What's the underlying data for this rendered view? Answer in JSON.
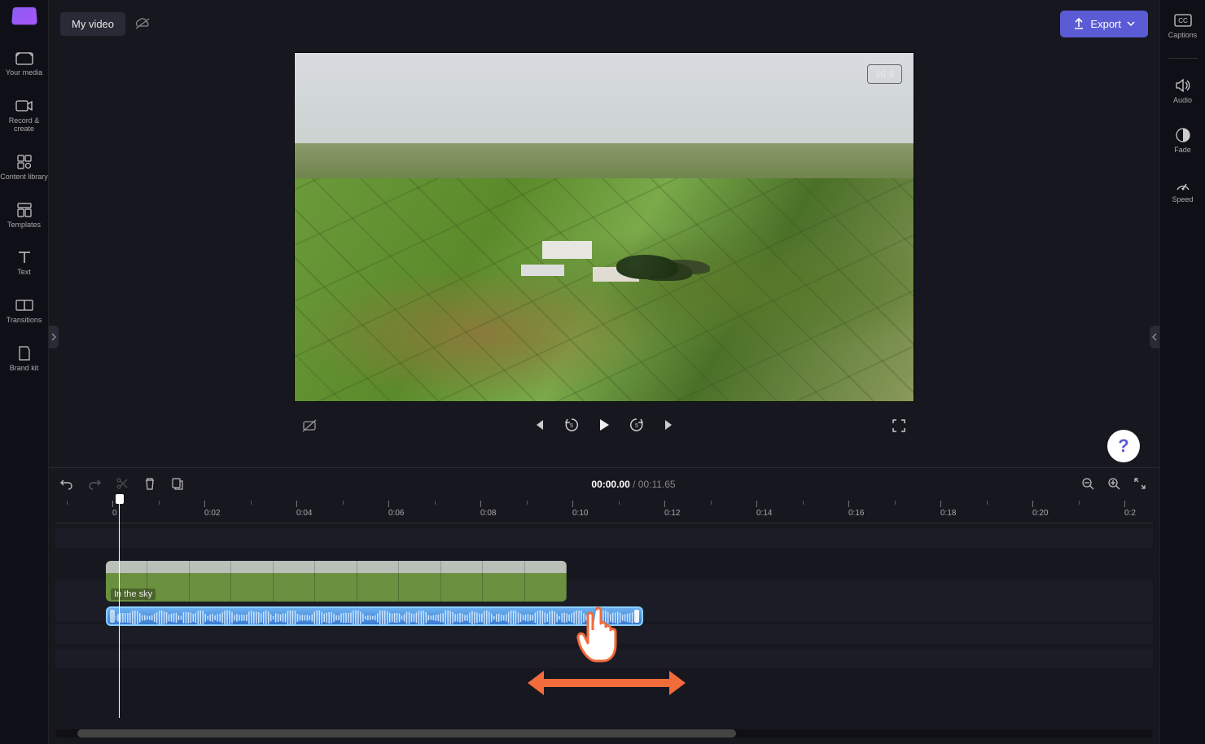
{
  "header": {
    "title": "My video",
    "export_label": "Export"
  },
  "left_sidebar": [
    {
      "label": "Your media"
    },
    {
      "label": "Record & create"
    },
    {
      "label": "Content library"
    },
    {
      "label": "Templates"
    },
    {
      "label": "Text"
    },
    {
      "label": "Transitions"
    },
    {
      "label": "Brand kit"
    }
  ],
  "right_sidebar": [
    {
      "label": "Captions"
    },
    {
      "label": "Audio"
    },
    {
      "label": "Fade"
    },
    {
      "label": "Speed"
    }
  ],
  "preview": {
    "aspect_label": "16:9"
  },
  "playback": {
    "current_time": "00:00.00",
    "total_time": "00:11.65"
  },
  "timeline": {
    "ruler_ticks": [
      "0",
      "0:02",
      "0:04",
      "0:06",
      "0:08",
      "0:10",
      "0:12",
      "0:14",
      "0:16",
      "0:18",
      "0:20",
      "0:2"
    ],
    "video_clip_label": "In the sky"
  },
  "help": {
    "label": "?"
  }
}
